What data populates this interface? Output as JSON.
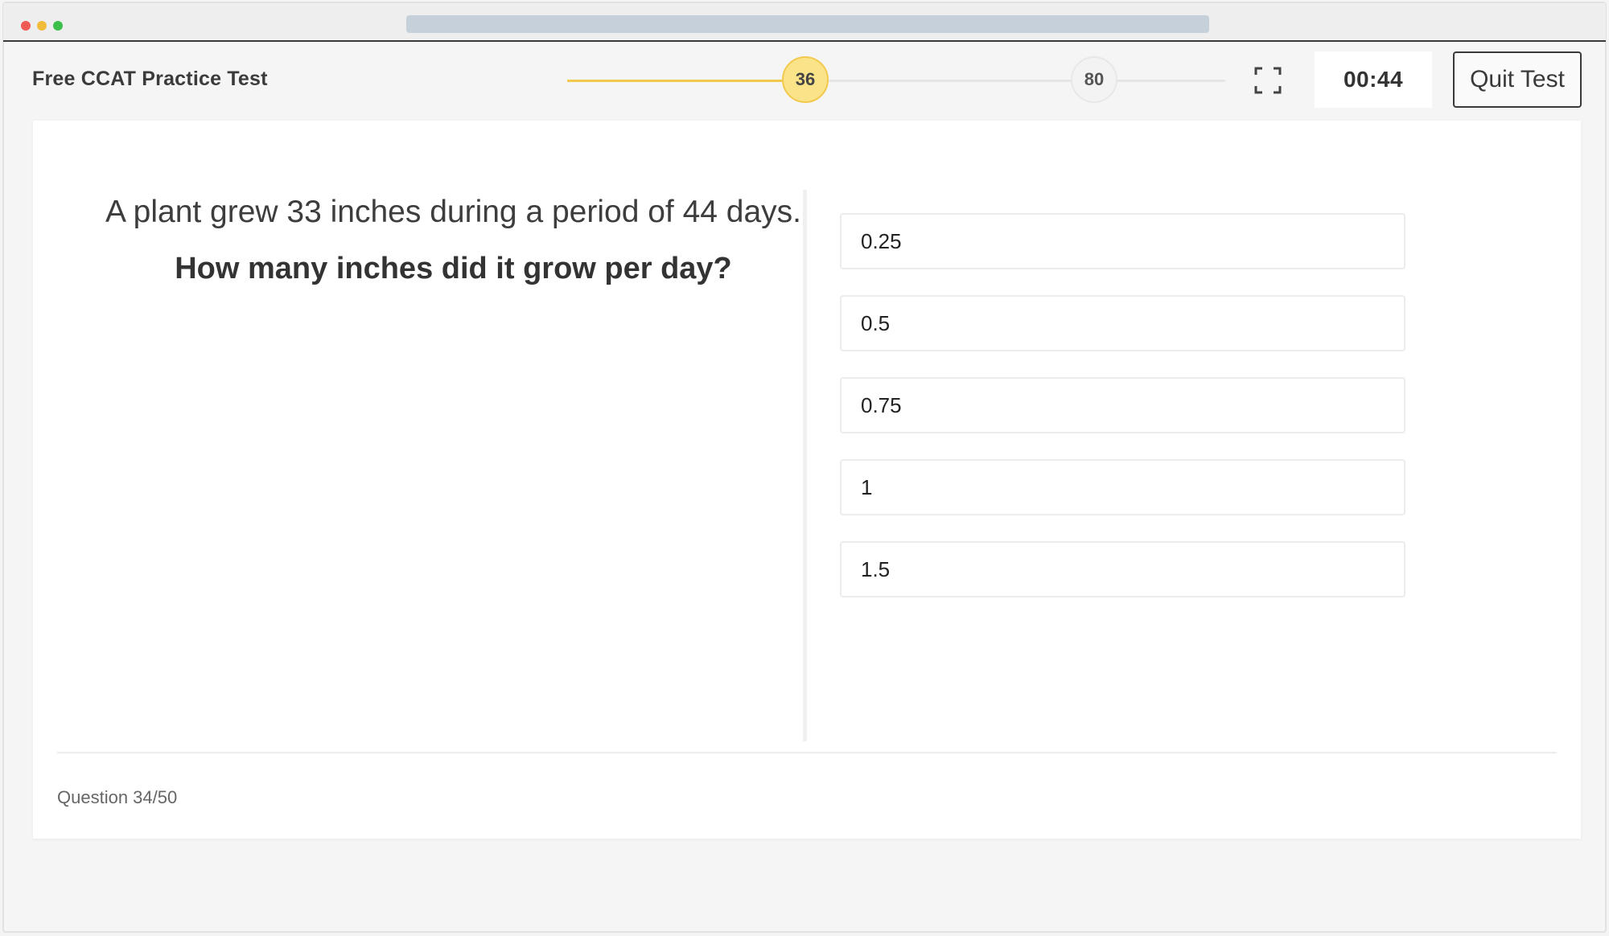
{
  "header": {
    "title": "Free CCAT Practice Test",
    "score_current": "36",
    "score_target": "80",
    "progress_fraction": 0.36,
    "timer": "00:44",
    "quit_label": "Quit Test",
    "fullscreen_icon": "fullscreen-icon"
  },
  "question": {
    "text": "A plant grew 33 inches during a period of 44 days.",
    "prompt": "How many inches did it grow per day?",
    "answers": [
      "0.25",
      "0.5",
      "0.75",
      "1",
      "1.5"
    ]
  },
  "footer": {
    "counter": "Question 34/50"
  },
  "colors": {
    "accent": "#f2c94c",
    "accent_light": "#fbe38a",
    "url_bar": "#c5d0db"
  }
}
